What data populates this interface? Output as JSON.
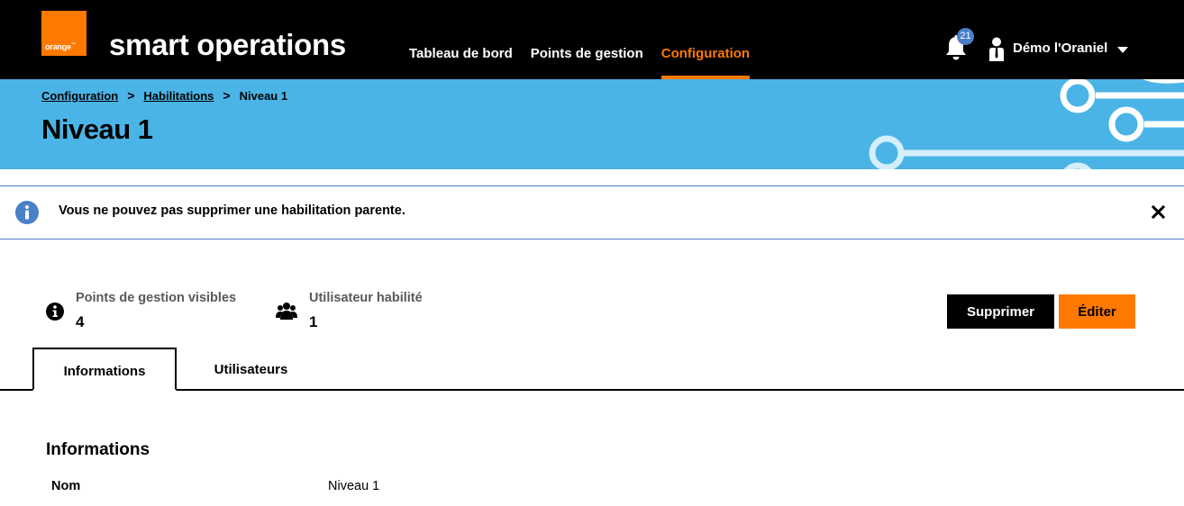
{
  "brand": {
    "logo_text": "orange",
    "logo_tm": "™",
    "app_name": "smart operations"
  },
  "nav": {
    "items": [
      {
        "label": "Tableau de bord",
        "active": false
      },
      {
        "label": "Points de gestion",
        "active": false
      },
      {
        "label": "Configuration",
        "active": true
      }
    ]
  },
  "notifications": {
    "count": "21"
  },
  "user": {
    "name": "Démo l'Oraniel"
  },
  "breadcrumb": {
    "items": [
      "Configuration",
      "Habilitations",
      "Niveau 1"
    ],
    "separator": ">"
  },
  "page": {
    "title": "Niveau 1"
  },
  "alert": {
    "message": "Vous ne pouvez pas supprimer une habilitation parente."
  },
  "stats": [
    {
      "label": "Points de gestion visibles",
      "value": "4",
      "icon": "info-icon"
    },
    {
      "label": "Utilisateur habilité",
      "value": "1",
      "icon": "users-icon"
    }
  ],
  "actions": {
    "delete_label": "Supprimer",
    "edit_label": "Éditer"
  },
  "tabs": [
    {
      "label": "Informations",
      "active": true
    },
    {
      "label": "Utilisateurs",
      "active": false
    }
  ],
  "info": {
    "section_title": "Informations",
    "fields": [
      {
        "label": "Nom",
        "value": "Niveau 1"
      }
    ]
  },
  "colors": {
    "brand_orange": "#ff7900",
    "header_bg": "#000000",
    "hero_bg": "#4bb4e6",
    "info_blue": "#4a80c8"
  }
}
